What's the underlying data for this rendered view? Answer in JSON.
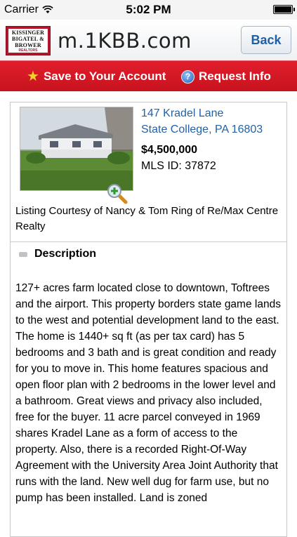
{
  "status_bar": {
    "carrier": "Carrier",
    "time": "5:02 PM"
  },
  "header": {
    "logo_lines": [
      "KISSINGER",
      "BIGATEL &",
      "BROWER"
    ],
    "logo_sub": "REALTORS",
    "site_title": "m.1KBB.com",
    "back_label": "Back"
  },
  "actions": {
    "save_label": "Save to Your Account",
    "info_label": "Request Info"
  },
  "listing": {
    "address_line1": "147 Kradel Lane",
    "address_line2": "State College, PA 16803",
    "price": "$4,500,000",
    "mls": "MLS ID: 37872",
    "courtesy": "Listing Courtesy of Nancy & Tom Ring of Re/Max Centre Realty"
  },
  "description": {
    "title": "Description",
    "body": "127+ acres farm located close to downtown, Toftrees and the airport. This property borders state game lands to the west and potential development land to the east. The home is 1440+ sq ft (as per tax card) has 5 bedrooms and 3 bath and is great condition and ready for you to move in. This home features spacious and open floor plan with 2 bedrooms in the lower level and a bathroom. Great views and privacy also included, free for the buyer. 11 acre parcel conveyed in 1969 shares Kradel Lane as a form of access to the property. Also, there is a recorded Right-Of-Way Agreement with the University Area Joint Authority that runs with the land. New well dug for farm use, but no pump has been installed. Land is zoned"
  },
  "colors": {
    "accent_red": "#d01a26",
    "link_blue": "#2361a6"
  }
}
